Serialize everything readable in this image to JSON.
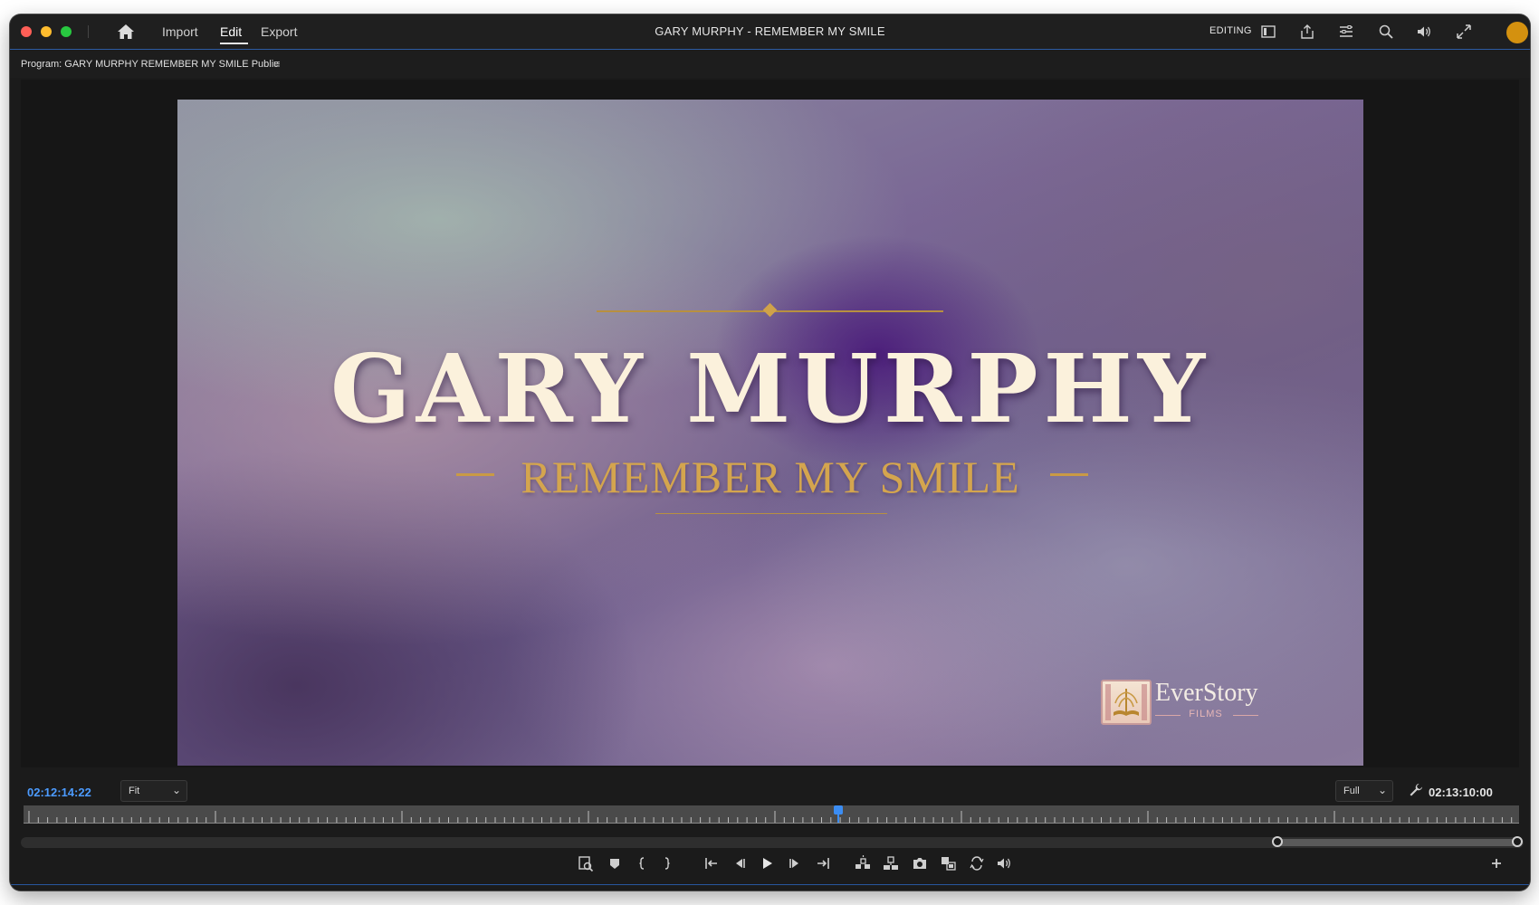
{
  "titlebar": {
    "nav": {
      "import": "Import",
      "edit": "Edit",
      "export": "Export"
    },
    "window_title": "GARY MURPHY - REMEMBER MY SMILE",
    "workspace_label": "EDITING",
    "icons": [
      "home-icon",
      "panel-layout-icon",
      "share-icon",
      "list-menu-icon",
      "search-icon",
      "volume-icon",
      "fullscreen-icon",
      "avatar"
    ]
  },
  "program_panel": {
    "title": "Program: GARY MURPHY REMEMBER MY SMILE Public",
    "menu_glyph": "≡"
  },
  "frame": {
    "main_title": "GARY MURPHY",
    "subtitle": "REMEMBER MY SMILE",
    "logo_name": "EverStory",
    "logo_sub": "FILMS"
  },
  "controls": {
    "timecode_current": "02:12:14:22",
    "zoom_select": {
      "value": "Fit"
    },
    "resolution_select": {
      "value": "Full"
    },
    "timecode_duration": "02:13:10:00",
    "playhead_fraction": 0.545,
    "transport_buttons": [
      "add-marker-icon",
      "marker-icon",
      "mark-in-icon",
      "mark-out-icon",
      "go-to-in-icon",
      "step-back-icon",
      "play-icon",
      "step-forward-icon",
      "go-to-out-icon",
      "lift-icon",
      "extract-icon",
      "export-frame-icon",
      "insert-icon",
      "loop-icon",
      "audio-icon",
      "add-button-icon"
    ]
  },
  "colors": {
    "accent": "#2d6fd6",
    "timecode_blue": "#4c9bff",
    "avatar": "#d4910f",
    "title_cream": "#fbf1dc",
    "subtitle_gold": "#d4a54e"
  }
}
